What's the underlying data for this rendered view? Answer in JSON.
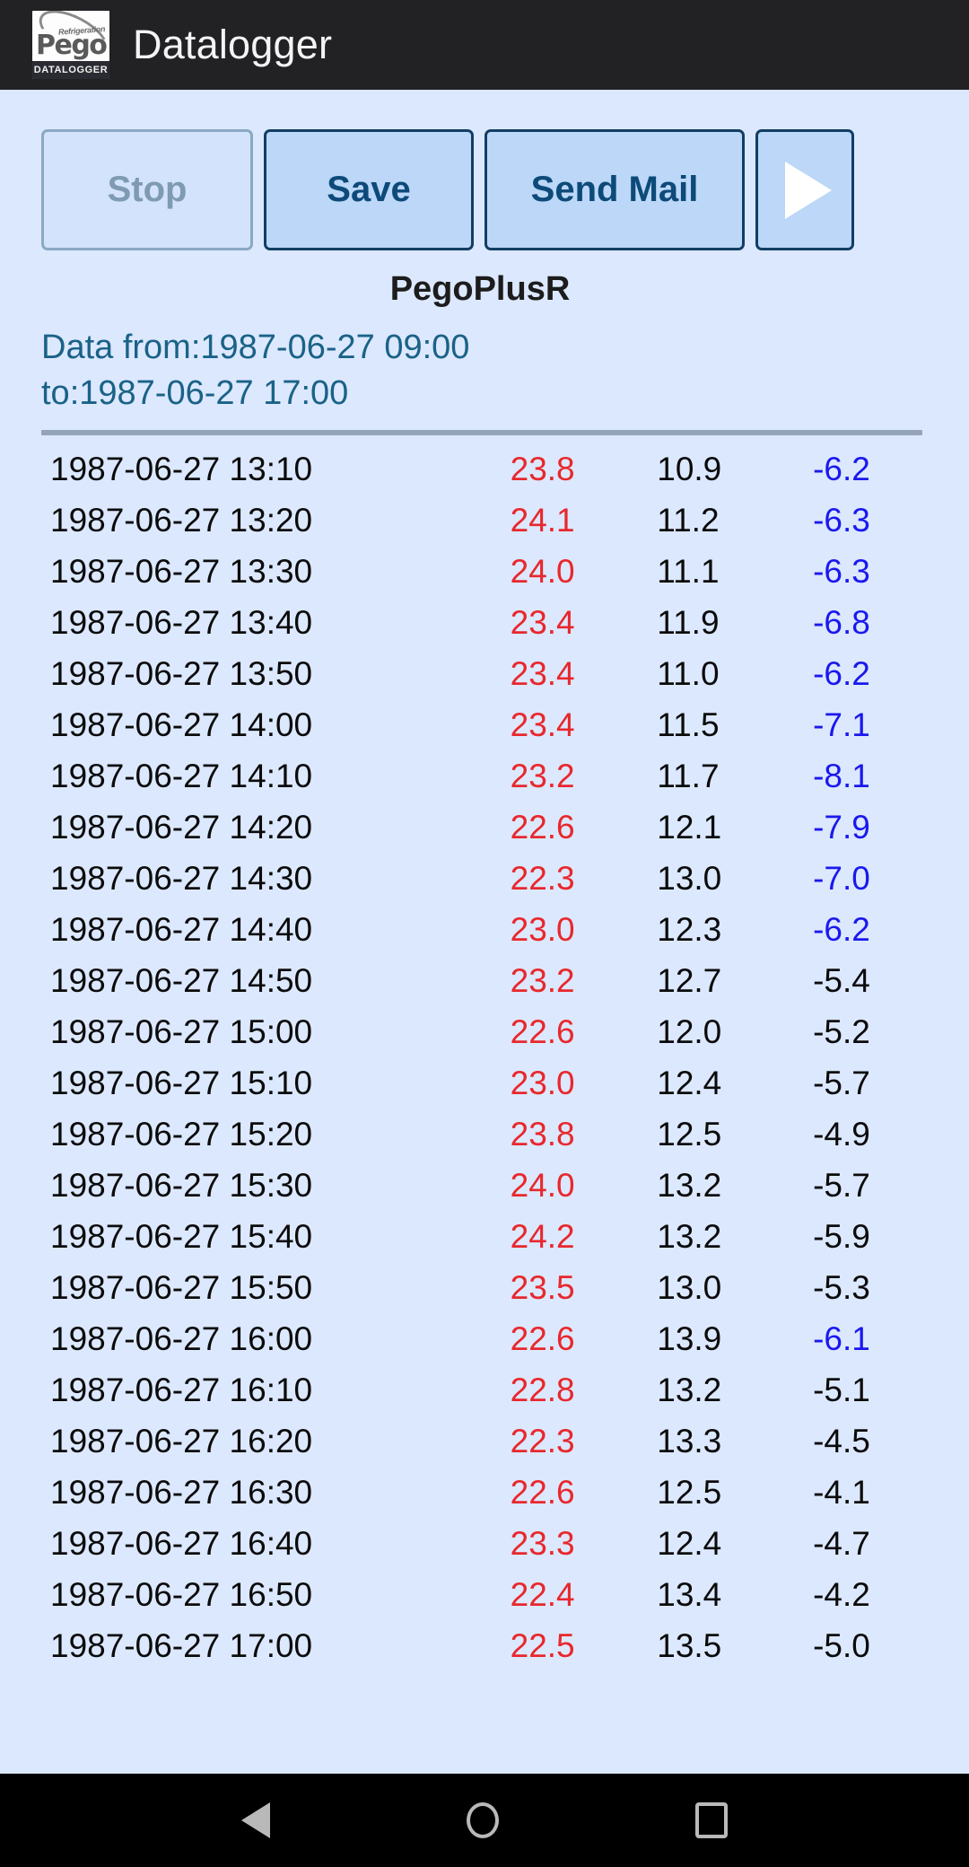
{
  "app_bar": {
    "title": "Datalogger",
    "logo": {
      "brand": "Pego",
      "tagline": "Refrigeration",
      "caption": "DATALOGGER"
    }
  },
  "toolbar": {
    "stop_label": "Stop",
    "save_label": "Save",
    "send_mail_label": "Send Mail",
    "play_icon": "play-icon"
  },
  "device_name": "PegoPlusR",
  "range": {
    "from_line": "Data from:1987-06-27 09:00",
    "to_line": "to:1987-06-27 17:00"
  },
  "colors": {
    "background": "#dce8fe",
    "app_bar": "#222225",
    "accent_blue": "#0d4a7a",
    "value_red": "#e8282d",
    "value_blue": "#1a18ee",
    "value_black": "#0b0b0b",
    "divider": "#95a5b8"
  },
  "table": {
    "rows": [
      {
        "timestamp": "1987-06-27 13:10",
        "v1": "23.8",
        "v2": "10.9",
        "v3": "-6.2",
        "v3_color": "blue"
      },
      {
        "timestamp": "1987-06-27 13:20",
        "v1": "24.1",
        "v2": "11.2",
        "v3": "-6.3",
        "v3_color": "blue"
      },
      {
        "timestamp": "1987-06-27 13:30",
        "v1": "24.0",
        "v2": "11.1",
        "v3": "-6.3",
        "v3_color": "blue"
      },
      {
        "timestamp": "1987-06-27 13:40",
        "v1": "23.4",
        "v2": "11.9",
        "v3": "-6.8",
        "v3_color": "blue"
      },
      {
        "timestamp": "1987-06-27 13:50",
        "v1": "23.4",
        "v2": "11.0",
        "v3": "-6.2",
        "v3_color": "blue"
      },
      {
        "timestamp": "1987-06-27 14:00",
        "v1": "23.4",
        "v2": "11.5",
        "v3": "-7.1",
        "v3_color": "blue"
      },
      {
        "timestamp": "1987-06-27 14:10",
        "v1": "23.2",
        "v2": "11.7",
        "v3": "-8.1",
        "v3_color": "blue"
      },
      {
        "timestamp": "1987-06-27 14:20",
        "v1": "22.6",
        "v2": "12.1",
        "v3": "-7.9",
        "v3_color": "blue"
      },
      {
        "timestamp": "1987-06-27 14:30",
        "v1": "22.3",
        "v2": "13.0",
        "v3": "-7.0",
        "v3_color": "blue"
      },
      {
        "timestamp": "1987-06-27 14:40",
        "v1": "23.0",
        "v2": "12.3",
        "v3": "-6.2",
        "v3_color": "blue"
      },
      {
        "timestamp": "1987-06-27 14:50",
        "v1": "23.2",
        "v2": "12.7",
        "v3": "-5.4",
        "v3_color": "black"
      },
      {
        "timestamp": "1987-06-27 15:00",
        "v1": "22.6",
        "v2": "12.0",
        "v3": "-5.2",
        "v3_color": "black"
      },
      {
        "timestamp": "1987-06-27 15:10",
        "v1": "23.0",
        "v2": "12.4",
        "v3": "-5.7",
        "v3_color": "black"
      },
      {
        "timestamp": "1987-06-27 15:20",
        "v1": "23.8",
        "v2": "12.5",
        "v3": "-4.9",
        "v3_color": "black"
      },
      {
        "timestamp": "1987-06-27 15:30",
        "v1": "24.0",
        "v2": "13.2",
        "v3": "-5.7",
        "v3_color": "black"
      },
      {
        "timestamp": "1987-06-27 15:40",
        "v1": "24.2",
        "v2": "13.2",
        "v3": "-5.9",
        "v3_color": "black"
      },
      {
        "timestamp": "1987-06-27 15:50",
        "v1": "23.5",
        "v2": "13.0",
        "v3": "-5.3",
        "v3_color": "black"
      },
      {
        "timestamp": "1987-06-27 16:00",
        "v1": "22.6",
        "v2": "13.9",
        "v3": "-6.1",
        "v3_color": "blue"
      },
      {
        "timestamp": "1987-06-27 16:10",
        "v1": "22.8",
        "v2": "13.2",
        "v3": "-5.1",
        "v3_color": "black"
      },
      {
        "timestamp": "1987-06-27 16:20",
        "v1": "22.3",
        "v2": "13.3",
        "v3": "-4.5",
        "v3_color": "black"
      },
      {
        "timestamp": "1987-06-27 16:30",
        "v1": "22.6",
        "v2": "12.5",
        "v3": "-4.1",
        "v3_color": "black"
      },
      {
        "timestamp": "1987-06-27 16:40",
        "v1": "23.3",
        "v2": "12.4",
        "v3": "-4.7",
        "v3_color": "black"
      },
      {
        "timestamp": "1987-06-27 16:50",
        "v1": "22.4",
        "v2": "13.4",
        "v3": "-4.2",
        "v3_color": "black"
      },
      {
        "timestamp": "1987-06-27 17:00",
        "v1": "22.5",
        "v2": "13.5",
        "v3": "-5.0",
        "v3_color": "black"
      }
    ]
  },
  "nav_bar": {
    "back": "back-icon",
    "home": "home-icon",
    "recents": "recents-icon"
  }
}
